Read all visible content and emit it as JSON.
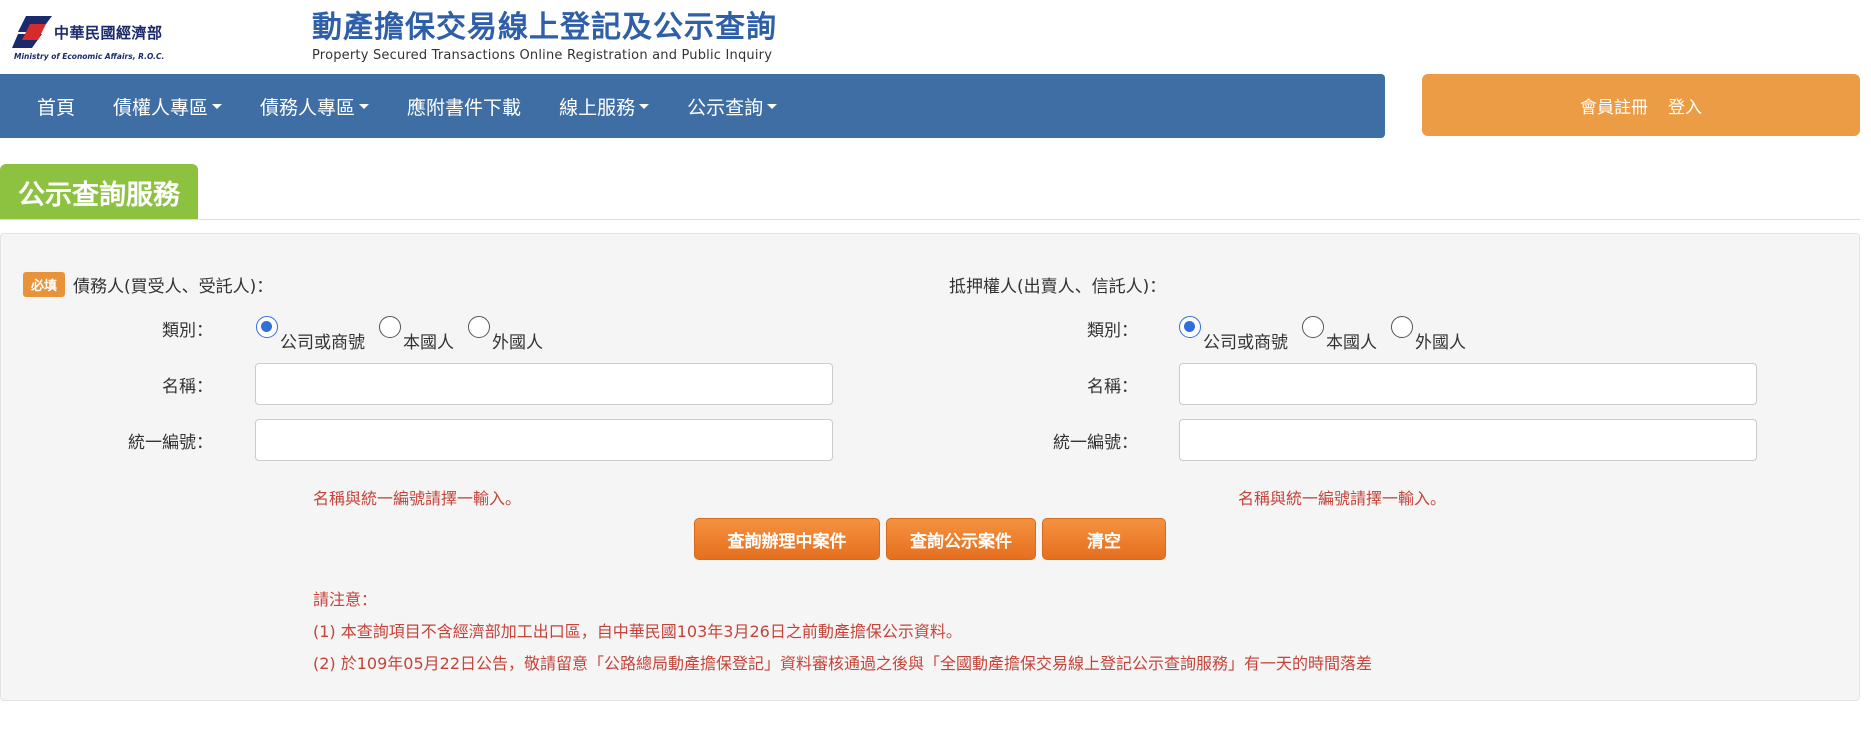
{
  "header": {
    "ministry_cn": "中華民國經濟部",
    "ministry_en": "Ministry of Economic Affairs, R.O.C.",
    "site_title_cn": "動產擔保交易線上登記及公示查詢",
    "site_title_en": "Property Secured Transactions Online Registration and Public Inquiry"
  },
  "nav": {
    "items": [
      {
        "label": "首頁",
        "dropdown": false
      },
      {
        "label": "債權人專區",
        "dropdown": true
      },
      {
        "label": "債務人專區",
        "dropdown": true
      },
      {
        "label": "應附書件下載",
        "dropdown": false
      },
      {
        "label": "線上服務",
        "dropdown": true
      },
      {
        "label": "公示查詢",
        "dropdown": true
      }
    ],
    "register": "會員註冊",
    "login": "登入"
  },
  "section": {
    "title": "公示查詢服務"
  },
  "form": {
    "required_badge": "必填",
    "debtor": {
      "title": "債務人(買受人、受託人)：",
      "type_label": "類別：",
      "type_options": [
        "公司或商號",
        "本國人",
        "外國人"
      ],
      "type_selected": "公司或商號",
      "name_label": "名稱：",
      "name_value": "",
      "id_label": "統一編號：",
      "id_value": "",
      "hint": "名稱與統一編號請擇一輸入。"
    },
    "mortgagee": {
      "title": "抵押權人(出賣人、信託人)：",
      "type_label": "類別：",
      "type_options": [
        "公司或商號",
        "本國人",
        "外國人"
      ],
      "type_selected": "公司或商號",
      "name_label": "名稱：",
      "name_value": "",
      "id_label": "統一編號：",
      "id_value": "",
      "hint": "名稱與統一編號請擇一輸入。"
    },
    "buttons": {
      "query_processing": "查詢辦理中案件",
      "query_public": "查詢公示案件",
      "clear": "清空"
    }
  },
  "notes": {
    "heading": "請注意：",
    "items": [
      "(1) 本查詢項目不含經濟部加工出口區，自中華民國103年3月26日之前動產擔保公示資料。",
      "(2) 於109年05月22日公告，敬請留意「公路總局動產擔保登記」資料審核通過之後與「全國動產擔保交易線上登記公示查詢服務」有一天的時間落差"
    ]
  },
  "colors": {
    "nav_bg": "#3e6ea3",
    "member_bg": "#eb9c45",
    "section_tab_bg": "#8dc140",
    "button_orange": "#ee7f2d",
    "hint_red": "#c4443a",
    "title_blue": "#2e5fa8"
  }
}
